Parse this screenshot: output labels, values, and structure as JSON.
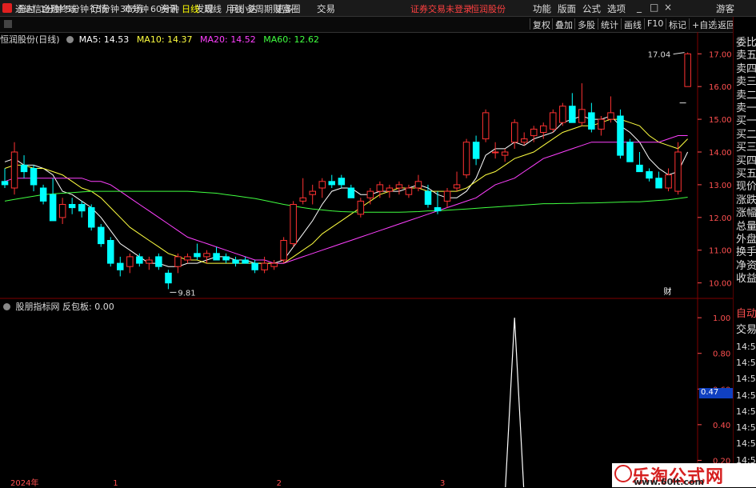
{
  "app": {
    "title": "通达信金融终端",
    "menu": [
      "行情",
      "市场",
      "资讯",
      "发现",
      "问小达",
      "财富圈",
      "交易"
    ],
    "warning": "证券交易未登录",
    "stock_name": "恒润股份",
    "right_menu": [
      "功能",
      "版面",
      "公式",
      "选项"
    ],
    "window_buttons": [
      "_",
      "□",
      "×"
    ],
    "guest": "游客"
  },
  "toolbar": {
    "periods": [
      "分时",
      "1分钟",
      "5分钟",
      "15分钟",
      "30分钟",
      "60分钟",
      "日线",
      "周线",
      "月线",
      "多周期",
      "更多"
    ],
    "active_period": "日线",
    "buttons": [
      "复权",
      "叠加",
      "多股",
      "统计",
      "画线",
      "F10",
      "标记",
      "+自选",
      "返回"
    ]
  },
  "info": {
    "name": "恒润股份(日线)",
    "ma": [
      {
        "label": "MA5: 14.53",
        "color": "#ffffff"
      },
      {
        "label": "MA10: 14.37",
        "color": "#ffff40"
      },
      {
        "label": "MA20: 14.52",
        "color": "#ff40ff"
      },
      {
        "label": "MA60: 12.62",
        "color": "#40ff40"
      }
    ]
  },
  "indicator": {
    "title": "股朋指标网 反包板: 0.00",
    "current_value": "0.47"
  },
  "colors": {
    "up": "#ff3232",
    "down": "#00ffff",
    "bg": "#000000",
    "grid": "#800000",
    "axis_text": "#ff5050",
    "ma5": "#ffffff",
    "ma10": "#ffff40",
    "ma20": "#ff40ff",
    "ma60": "#40ff40"
  },
  "right_panel": {
    "top": [
      "委比",
      "卖五",
      "卖四",
      "卖三",
      "卖二",
      "卖一",
      "买一",
      "买二",
      "买三",
      "买四",
      "买五",
      "现价",
      "涨跌",
      "涨幅",
      "总量",
      "外盘",
      "换手",
      "净资",
      "收益"
    ],
    "bottom": [
      "自动",
      "交易",
      "14:56",
      "14:56",
      "14:56",
      "14:56",
      "14:56",
      "14:56",
      "14:56",
      "14:56",
      "14:56"
    ]
  },
  "watermark": {
    "title": "乐淘公式网",
    "url": "www.60lt.com"
  },
  "chart_data": {
    "type": "candlestick",
    "price_axis": {
      "ticks": [
        17.0,
        16.0,
        15.0,
        14.0,
        13.0,
        12.0,
        11.0,
        10.0
      ],
      "range": [
        9.6,
        17.3
      ]
    },
    "indicator_axis": {
      "ticks": [
        1.0,
        0.8,
        0.6,
        0.4,
        0.2
      ],
      "range": [
        0,
        1.05
      ]
    },
    "x_labels": [
      "2024年",
      "1",
      "2",
      "3"
    ],
    "x_label_index": [
      1,
      11,
      28,
      45
    ],
    "annotations": {
      "high": "17.04",
      "low": "9.81",
      "finance_marker": "财"
    },
    "candles": [
      {
        "o": 13.1,
        "h": 13.5,
        "l": 12.9,
        "c": 13.0
      },
      {
        "o": 12.9,
        "h": 14.3,
        "l": 12.7,
        "c": 14.0
      },
      {
        "o": 13.6,
        "h": 13.9,
        "l": 13.2,
        "c": 13.4
      },
      {
        "o": 13.5,
        "h": 13.6,
        "l": 12.8,
        "c": 13.0
      },
      {
        "o": 12.9,
        "h": 13.0,
        "l": 12.4,
        "c": 12.5
      },
      {
        "o": 12.7,
        "h": 13.2,
        "l": 11.9,
        "c": 11.9
      },
      {
        "o": 12.0,
        "h": 12.6,
        "l": 11.8,
        "c": 12.4
      },
      {
        "o": 12.4,
        "h": 12.6,
        "l": 12.1,
        "c": 12.3
      },
      {
        "o": 12.4,
        "h": 12.5,
        "l": 12.0,
        "c": 12.2
      },
      {
        "o": 12.3,
        "h": 12.4,
        "l": 11.6,
        "c": 11.7
      },
      {
        "o": 11.7,
        "h": 11.8,
        "l": 11.1,
        "c": 11.2
      },
      {
        "o": 11.3,
        "h": 11.4,
        "l": 10.5,
        "c": 10.6
      },
      {
        "o": 10.6,
        "h": 10.8,
        "l": 10.2,
        "c": 10.4
      },
      {
        "o": 10.5,
        "h": 10.9,
        "l": 10.3,
        "c": 10.8
      },
      {
        "o": 10.8,
        "h": 10.9,
        "l": 10.5,
        "c": 10.6
      },
      {
        "o": 10.6,
        "h": 10.8,
        "l": 10.4,
        "c": 10.7
      },
      {
        "o": 10.8,
        "h": 10.9,
        "l": 10.4,
        "c": 10.5
      },
      {
        "o": 10.3,
        "h": 10.4,
        "l": 9.81,
        "c": 10.0
      },
      {
        "o": 10.5,
        "h": 10.9,
        "l": 10.3,
        "c": 10.8
      },
      {
        "o": 10.7,
        "h": 10.9,
        "l": 10.6,
        "c": 10.8
      },
      {
        "o": 10.9,
        "h": 11.2,
        "l": 10.7,
        "c": 10.8
      },
      {
        "o": 10.8,
        "h": 11.0,
        "l": 10.6,
        "c": 10.9
      },
      {
        "o": 10.9,
        "h": 11.1,
        "l": 10.7,
        "c": 10.7
      },
      {
        "o": 10.8,
        "h": 10.9,
        "l": 10.6,
        "c": 10.7
      },
      {
        "o": 10.7,
        "h": 10.8,
        "l": 10.5,
        "c": 10.6
      },
      {
        "o": 10.7,
        "h": 10.8,
        "l": 10.6,
        "c": 10.6
      },
      {
        "o": 10.6,
        "h": 10.7,
        "l": 10.3,
        "c": 10.4
      },
      {
        "o": 10.4,
        "h": 10.8,
        "l": 10.3,
        "c": 10.6
      },
      {
        "o": 10.5,
        "h": 10.7,
        "l": 10.4,
        "c": 10.6
      },
      {
        "o": 10.7,
        "h": 11.4,
        "l": 10.6,
        "c": 11.3
      },
      {
        "o": 11.2,
        "h": 12.5,
        "l": 11.1,
        "c": 12.4
      },
      {
        "o": 12.5,
        "h": 13.2,
        "l": 12.4,
        "c": 12.6
      },
      {
        "o": 12.7,
        "h": 13.0,
        "l": 12.4,
        "c": 12.8
      },
      {
        "o": 12.9,
        "h": 13.2,
        "l": 12.6,
        "c": 13.1
      },
      {
        "o": 13.1,
        "h": 13.3,
        "l": 12.9,
        "c": 13.0
      },
      {
        "o": 13.2,
        "h": 13.3,
        "l": 12.9,
        "c": 13.0
      },
      {
        "o": 12.9,
        "h": 13.0,
        "l": 12.6,
        "c": 12.6
      },
      {
        "o": 12.1,
        "h": 12.6,
        "l": 12.0,
        "c": 12.5
      },
      {
        "o": 12.6,
        "h": 12.9,
        "l": 12.4,
        "c": 12.8
      },
      {
        "o": 12.8,
        "h": 13.1,
        "l": 12.6,
        "c": 13.0
      },
      {
        "o": 12.8,
        "h": 13.0,
        "l": 12.6,
        "c": 12.9
      },
      {
        "o": 12.9,
        "h": 13.1,
        "l": 12.7,
        "c": 13.0
      },
      {
        "o": 12.7,
        "h": 13.0,
        "l": 12.6,
        "c": 12.9
      },
      {
        "o": 12.9,
        "h": 13.3,
        "l": 12.8,
        "c": 13.1
      },
      {
        "o": 12.8,
        "h": 13.0,
        "l": 12.3,
        "c": 12.4
      },
      {
        "o": 12.3,
        "h": 12.8,
        "l": 12.1,
        "c": 12.2
      },
      {
        "o": 12.5,
        "h": 12.9,
        "l": 12.3,
        "c": 12.8
      },
      {
        "o": 12.9,
        "h": 13.4,
        "l": 12.8,
        "c": 13.0
      },
      {
        "o": 13.3,
        "h": 14.4,
        "l": 13.2,
        "c": 14.3
      },
      {
        "o": 14.3,
        "h": 14.5,
        "l": 13.6,
        "c": 13.8
      },
      {
        "o": 14.4,
        "h": 15.3,
        "l": 14.3,
        "c": 15.2
      },
      {
        "o": 14.0,
        "h": 14.3,
        "l": 13.8,
        "c": 14.0
      },
      {
        "o": 13.9,
        "h": 14.1,
        "l": 13.7,
        "c": 14.0
      },
      {
        "o": 14.3,
        "h": 15.0,
        "l": 14.1,
        "c": 14.9
      },
      {
        "o": 14.3,
        "h": 14.6,
        "l": 14.2,
        "c": 14.4
      },
      {
        "o": 14.5,
        "h": 14.8,
        "l": 14.3,
        "c": 14.7
      },
      {
        "o": 14.6,
        "h": 14.9,
        "l": 14.4,
        "c": 14.8
      },
      {
        "o": 14.7,
        "h": 15.3,
        "l": 14.6,
        "c": 15.2
      },
      {
        "o": 14.9,
        "h": 15.5,
        "l": 14.8,
        "c": 15.4
      },
      {
        "o": 15.4,
        "h": 15.8,
        "l": 15.0,
        "c": 14.9
      },
      {
        "o": 14.9,
        "h": 16.1,
        "l": 14.8,
        "c": 15.3
      },
      {
        "o": 15.2,
        "h": 15.5,
        "l": 14.6,
        "c": 14.7
      },
      {
        "o": 14.7,
        "h": 15.1,
        "l": 14.5,
        "c": 15.0
      },
      {
        "o": 15.0,
        "h": 15.7,
        "l": 14.9,
        "c": 15.2
      },
      {
        "o": 15.1,
        "h": 15.3,
        "l": 13.8,
        "c": 13.9
      },
      {
        "o": 14.3,
        "h": 14.4,
        "l": 13.7,
        "c": 13.7
      },
      {
        "o": 13.6,
        "h": 14.0,
        "l": 13.4,
        "c": 13.4
      },
      {
        "o": 13.4,
        "h": 13.5,
        "l": 13.1,
        "c": 13.2
      },
      {
        "o": 13.2,
        "h": 13.4,
        "l": 12.9,
        "c": 12.9
      },
      {
        "o": 12.9,
        "h": 13.5,
        "l": 12.8,
        "c": 13.3
      },
      {
        "o": 12.8,
        "h": 14.3,
        "l": 12.7,
        "c": 14.0
      },
      {
        "o": 16.0,
        "h": 17.04,
        "l": 16.0,
        "c": 17.0
      }
    ],
    "ma_series": [
      {
        "name": "MA5",
        "values": [
          13.7,
          13.8,
          13.6,
          13.6,
          13.5,
          13.3,
          12.8,
          12.7,
          12.5,
          12.3,
          12.0,
          11.6,
          11.2,
          11.0,
          10.8,
          10.6,
          10.6,
          10.5,
          10.5,
          10.6,
          10.6,
          10.7,
          10.8,
          10.8,
          10.7,
          10.7,
          10.6,
          10.6,
          10.6,
          10.7,
          11.1,
          11.5,
          11.9,
          12.4,
          12.8,
          12.9,
          12.9,
          12.7,
          12.7,
          12.8,
          12.8,
          12.8,
          12.9,
          13.0,
          12.9,
          12.7,
          12.6,
          12.6,
          12.8,
          13.2,
          13.9,
          14.1,
          14.1,
          14.3,
          14.2,
          14.4,
          14.5,
          14.6,
          14.9,
          15.0,
          15.1,
          15.0,
          15.0,
          15.1,
          14.8,
          14.6,
          14.3,
          13.8,
          13.5,
          13.3,
          13.4,
          14.0
        ]
      },
      {
        "name": "MA10",
        "values": [
          13.5,
          13.6,
          13.6,
          13.5,
          13.5,
          13.4,
          13.3,
          13.1,
          12.9,
          12.8,
          12.6,
          12.3,
          12.0,
          11.7,
          11.5,
          11.3,
          11.1,
          10.9,
          10.8,
          10.7,
          10.7,
          10.6,
          10.6,
          10.6,
          10.6,
          10.6,
          10.6,
          10.6,
          10.6,
          10.6,
          10.8,
          11.0,
          11.2,
          11.5,
          11.7,
          11.9,
          12.1,
          12.3,
          12.5,
          12.7,
          12.8,
          12.9,
          12.9,
          12.9,
          12.8,
          12.8,
          12.8,
          12.8,
          12.9,
          13.1,
          13.3,
          13.4,
          13.6,
          13.8,
          13.9,
          14.0,
          14.2,
          14.4,
          14.6,
          14.7,
          14.8,
          14.8,
          14.9,
          15.0,
          15.0,
          14.9,
          14.8,
          14.5,
          14.3,
          14.2,
          14.1,
          14.4
        ]
      },
      {
        "name": "MA20",
        "values": [
          13.1,
          13.2,
          13.2,
          13.2,
          13.2,
          13.2,
          13.2,
          13.2,
          13.2,
          13.1,
          13.1,
          13.0,
          12.8,
          12.6,
          12.4,
          12.2,
          12.0,
          11.8,
          11.6,
          11.4,
          11.3,
          11.2,
          11.1,
          11.0,
          10.9,
          10.8,
          10.7,
          10.7,
          10.6,
          10.6,
          10.7,
          10.8,
          10.9,
          11.0,
          11.1,
          11.2,
          11.3,
          11.4,
          11.5,
          11.6,
          11.7,
          11.8,
          11.9,
          12.0,
          12.1,
          12.2,
          12.3,
          12.4,
          12.5,
          12.6,
          12.8,
          13.0,
          13.1,
          13.2,
          13.4,
          13.6,
          13.8,
          13.9,
          14.0,
          14.1,
          14.2,
          14.3,
          14.3,
          14.3,
          14.3,
          14.3,
          14.3,
          14.3,
          14.3,
          14.4,
          14.5,
          14.5
        ]
      },
      {
        "name": "MA60",
        "values": [
          12.5,
          12.55,
          12.6,
          12.65,
          12.7,
          12.72,
          12.74,
          12.76,
          12.78,
          12.8,
          12.8,
          12.8,
          12.8,
          12.8,
          12.8,
          12.8,
          12.8,
          12.8,
          12.8,
          12.8,
          12.78,
          12.76,
          12.74,
          12.7,
          12.66,
          12.62,
          12.58,
          12.52,
          12.46,
          12.4,
          12.35,
          12.3,
          12.26,
          12.23,
          12.2,
          12.18,
          12.17,
          12.16,
          12.16,
          12.16,
          12.16,
          12.16,
          12.17,
          12.18,
          12.2,
          12.2,
          12.22,
          12.24,
          12.26,
          12.28,
          12.3,
          12.32,
          12.34,
          12.36,
          12.38,
          12.4,
          12.42,
          12.42,
          12.43,
          12.43,
          12.44,
          12.44,
          12.45,
          12.46,
          12.47,
          12.48,
          12.48,
          12.5,
          12.52,
          12.54,
          12.58,
          12.62
        ]
      }
    ],
    "indicator_series": {
      "name": "反包板",
      "spike_index": 53,
      "spike_value": 1.0
    }
  }
}
